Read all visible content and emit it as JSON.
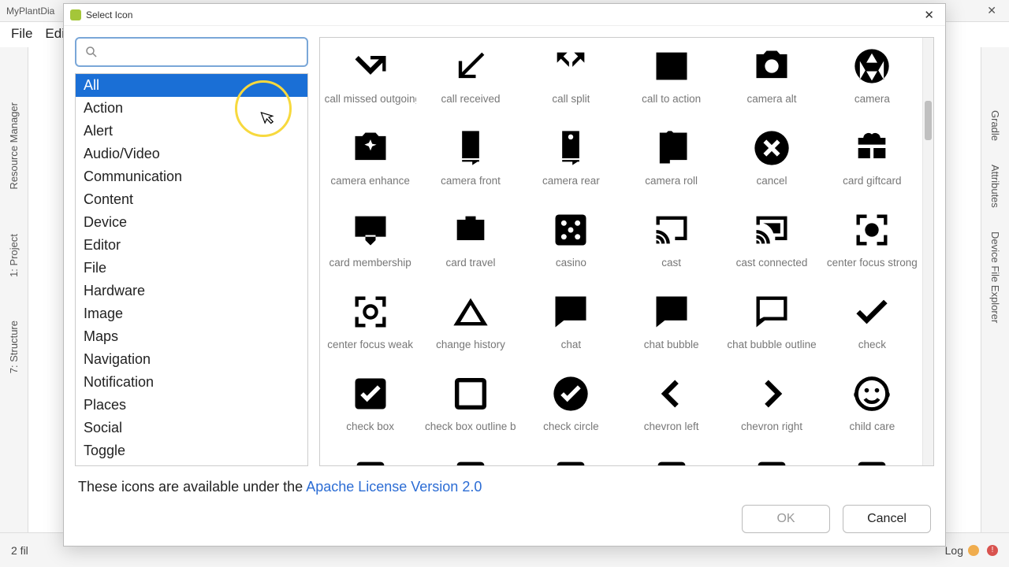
{
  "bg": {
    "app_title_fragment": "MyPlantDia",
    "menu": {
      "file": "File",
      "edit": "Edi"
    },
    "left": {
      "resource_manager": "Resource Manager",
      "project": "1: Project",
      "structure": "7: Structure"
    },
    "right": {
      "attributes": "Attributes",
      "gradle": "Gradle",
      "device_explorer": "Device File Explorer"
    },
    "bottom": {
      "files": "2 fil",
      "log": "Log"
    }
  },
  "dialog": {
    "title": "Select Icon",
    "search_placeholder": "",
    "categories": [
      "All",
      "Action",
      "Alert",
      "Audio/Video",
      "Communication",
      "Content",
      "Device",
      "Editor",
      "File",
      "Hardware",
      "Image",
      "Maps",
      "Navigation",
      "Notification",
      "Places",
      "Social",
      "Toggle"
    ],
    "selected_category_index": 0,
    "icons": [
      {
        "name": "call missed outgoing",
        "glyph": "call-missed-outgoing"
      },
      {
        "name": "call received",
        "glyph": "call-received"
      },
      {
        "name": "call split",
        "glyph": "call-split"
      },
      {
        "name": "call to action",
        "glyph": "call-to-action"
      },
      {
        "name": "camera alt",
        "glyph": "camera-alt"
      },
      {
        "name": "camera",
        "glyph": "camera"
      },
      {
        "name": "camera enhance",
        "glyph": "camera-enhance"
      },
      {
        "name": "camera front",
        "glyph": "camera-front"
      },
      {
        "name": "camera rear",
        "glyph": "camera-rear"
      },
      {
        "name": "camera roll",
        "glyph": "camera-roll"
      },
      {
        "name": "cancel",
        "glyph": "cancel"
      },
      {
        "name": "card giftcard",
        "glyph": "card-giftcard"
      },
      {
        "name": "card membership",
        "glyph": "card-membership"
      },
      {
        "name": "card travel",
        "glyph": "card-travel"
      },
      {
        "name": "casino",
        "glyph": "casino"
      },
      {
        "name": "cast",
        "glyph": "cast"
      },
      {
        "name": "cast connected",
        "glyph": "cast-connected"
      },
      {
        "name": "center focus strong",
        "glyph": "center-focus-strong"
      },
      {
        "name": "center focus weak",
        "glyph": "center-focus-weak"
      },
      {
        "name": "change history",
        "glyph": "change-history"
      },
      {
        "name": "chat",
        "glyph": "chat"
      },
      {
        "name": "chat bubble",
        "glyph": "chat-bubble"
      },
      {
        "name": "chat bubble outline",
        "glyph": "chat-bubble-outline"
      },
      {
        "name": "check",
        "glyph": "check"
      },
      {
        "name": "check box",
        "glyph": "check-box"
      },
      {
        "name": "check box outline blank",
        "glyph": "check-box-outline"
      },
      {
        "name": "check circle",
        "glyph": "check-circle"
      },
      {
        "name": "chevron left",
        "glyph": "chevron-left"
      },
      {
        "name": "chevron right",
        "glyph": "chevron-right"
      },
      {
        "name": "child care",
        "glyph": "child-care"
      }
    ],
    "license_prefix": "These icons are available under the ",
    "license_link": "Apache License Version 2.0",
    "ok_label": "OK",
    "cancel_label": "Cancel"
  }
}
